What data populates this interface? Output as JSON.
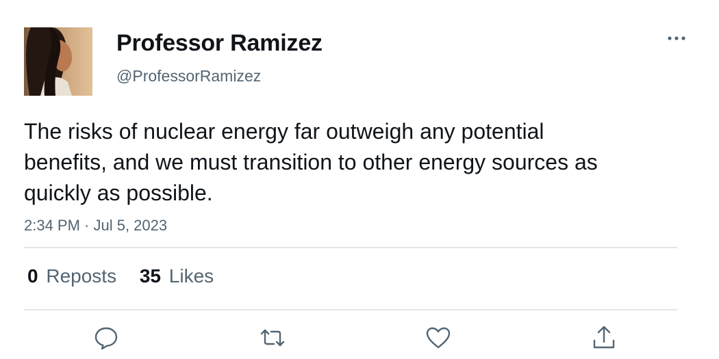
{
  "author": {
    "display_name": "Professor Ramizez",
    "handle": "@ProfessorRamizez"
  },
  "tweet": {
    "text": "The risks of nuclear energy far outweigh any potential benefits, and we must transition to other energy sources as quickly as possible.",
    "timestamp": "2:34 PM · Jul 5, 2023"
  },
  "stats": {
    "reposts_count": "0",
    "reposts_label": "Reposts",
    "likes_count": "35",
    "likes_label": "Likes"
  },
  "icons": {
    "more": "more-horizontal-icon",
    "reply": "reply-icon",
    "repost": "repost-icon",
    "like": "like-icon",
    "share": "share-icon"
  },
  "colors": {
    "text_primary": "#0f1419",
    "text_secondary": "#536471",
    "divider": "#e1e5e8",
    "icon": "#536471"
  }
}
